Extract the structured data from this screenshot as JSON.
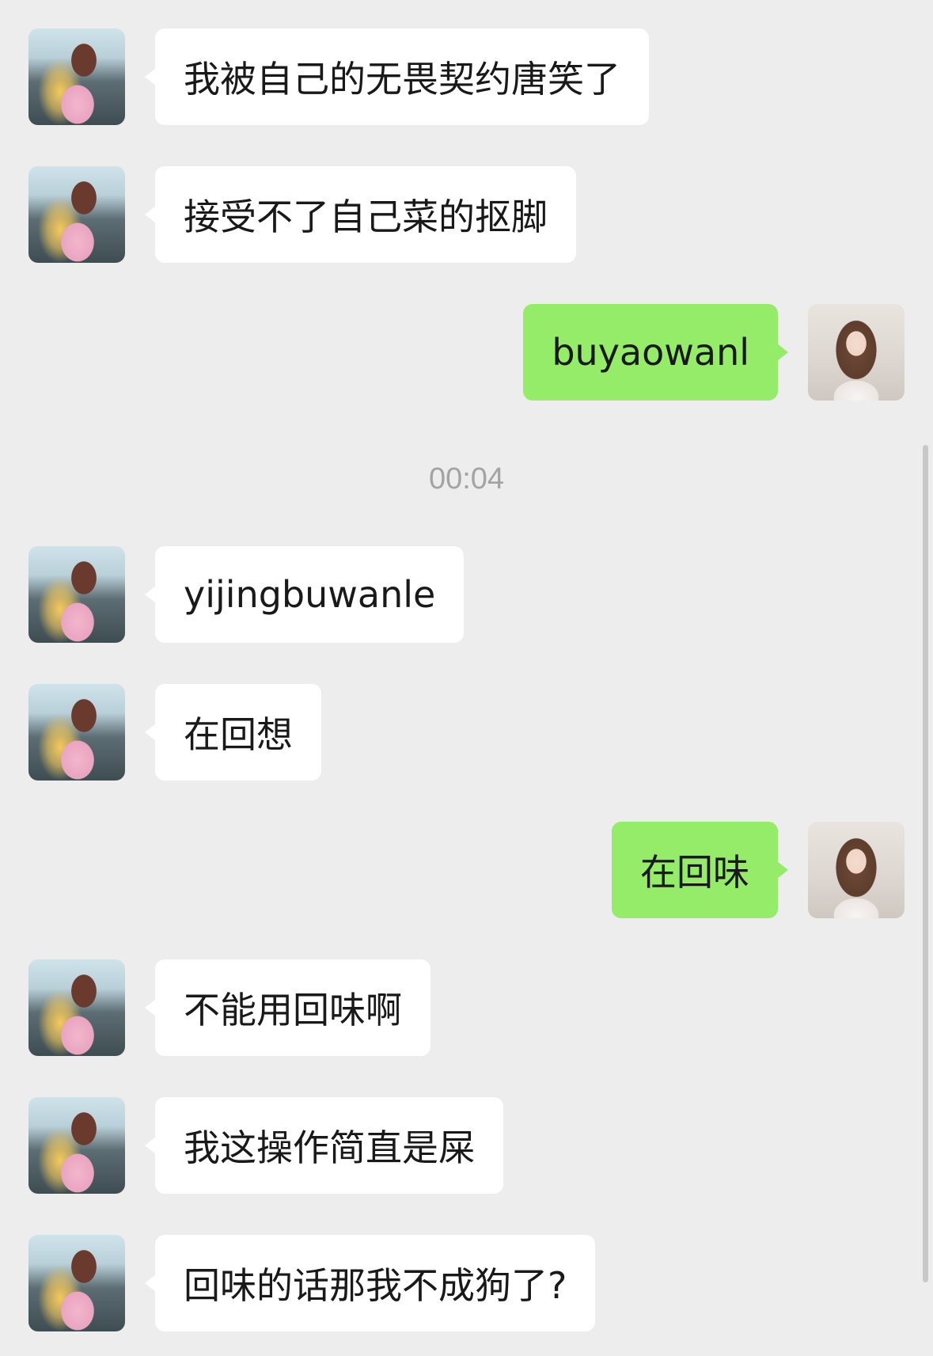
{
  "timestamp": "00:04",
  "messages": [
    {
      "side": "left",
      "text": "我被自己的无畏契约唐笑了"
    },
    {
      "side": "left",
      "text": "接受不了自己菜的抠脚"
    },
    {
      "side": "right",
      "text": "buyaowanl"
    },
    {
      "side": "left",
      "text": "yijingbuwanle"
    },
    {
      "side": "left",
      "text": "在回想"
    },
    {
      "side": "right",
      "text": "在回味"
    },
    {
      "side": "left",
      "text": "不能用回味啊"
    },
    {
      "side": "left",
      "text": "我这操作简直是屎"
    },
    {
      "side": "left",
      "text": "回味的话那我不成狗了?"
    }
  ],
  "colors": {
    "background": "#ededed",
    "incoming_bubble": "#ffffff",
    "outgoing_bubble": "#95ec69",
    "timestamp_text": "#a3a3a3"
  }
}
